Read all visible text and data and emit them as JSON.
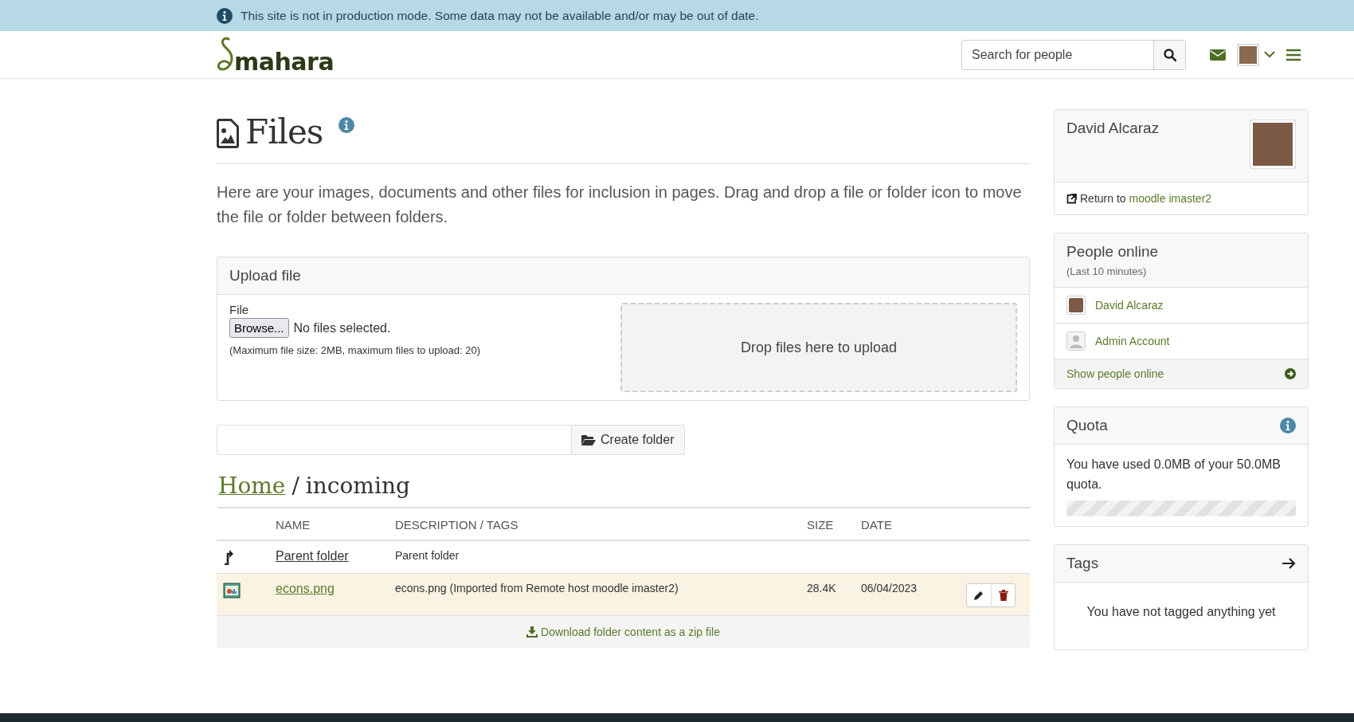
{
  "banner": {
    "text": "This site is not in production mode. Some data may not be available and/or may be out of date."
  },
  "header": {
    "logo": "mahara",
    "search": {
      "placeholder": "Search for people"
    }
  },
  "page": {
    "title": "Files",
    "intro": "Here are your images, documents and other files for inclusion in pages. Drag and drop a file or folder icon to move the file or folder between folders.",
    "upload": {
      "title": "Upload file",
      "file_label": "File",
      "browse_button": "Browse...",
      "file_status": "No files selected.",
      "hint": "(Maximum file size: 2MB, maximum files to upload: 20)",
      "dropzone": "Drop files here to upload"
    },
    "create_folder": {
      "button": "Create folder"
    },
    "breadcrumb": {
      "separator": "/",
      "items": [
        {
          "label": "Home",
          "kind": "link"
        },
        {
          "label": "incoming",
          "kind": "current"
        }
      ]
    },
    "table": {
      "columns": [
        "NAME",
        "DESCRIPTION / TAGS",
        "SIZE",
        "DATE"
      ],
      "rows": [
        {
          "kind": "parent",
          "name": "Parent folder",
          "description": "Parent folder",
          "selected": false
        },
        {
          "kind": "file",
          "name": "econs.png",
          "description": "econs.png (Imported from Remote host moodle imaster2)",
          "size": "28.4K",
          "date": "06/04/2023",
          "selected": true
        }
      ]
    },
    "download_link": "Download folder content as a zip file"
  },
  "sidebar": {
    "profile": {
      "name": "David Alcaraz",
      "return_prefix": "Return to",
      "return_link": "moodle imaster2"
    },
    "people_online": {
      "title": "People online",
      "subtitle": "(Last 10 minutes)",
      "people": [
        {
          "name": "David Alcaraz",
          "kind": "photo"
        },
        {
          "name": "Admin Account",
          "kind": "default"
        }
      ],
      "show_link": "Show people online"
    },
    "quota": {
      "title": "Quota",
      "text": "You have used 0.0MB of your 50.0MB quota.",
      "level": 0
    },
    "tags": {
      "title": "Tags",
      "empty_text": "You have not tagged anything yet"
    }
  }
}
